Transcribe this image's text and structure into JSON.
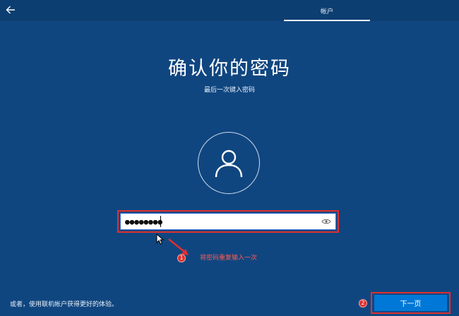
{
  "header": {
    "back_icon": "arrow-left-icon",
    "tab_label": "帐户"
  },
  "main": {
    "title": "确认你的密码",
    "subtitle": "最后一次键入密码",
    "avatar_icon": "user-icon",
    "password_field": {
      "value": "●●●●●●●●",
      "masked_length": 8,
      "reveal_icon": "eye-icon"
    }
  },
  "annotations": {
    "step1_badge": "1",
    "step1_text": "将密码重复输入一次",
    "step2_badge": "2",
    "highlight_color": "#e0302f"
  },
  "footer": {
    "online_account_link": "或者，使用联机帐户获得更好的体验。",
    "next_button": "下一页"
  },
  "colors": {
    "background": "#104680",
    "topbar": "#0d3e72",
    "accent_button": "#0078d7"
  }
}
